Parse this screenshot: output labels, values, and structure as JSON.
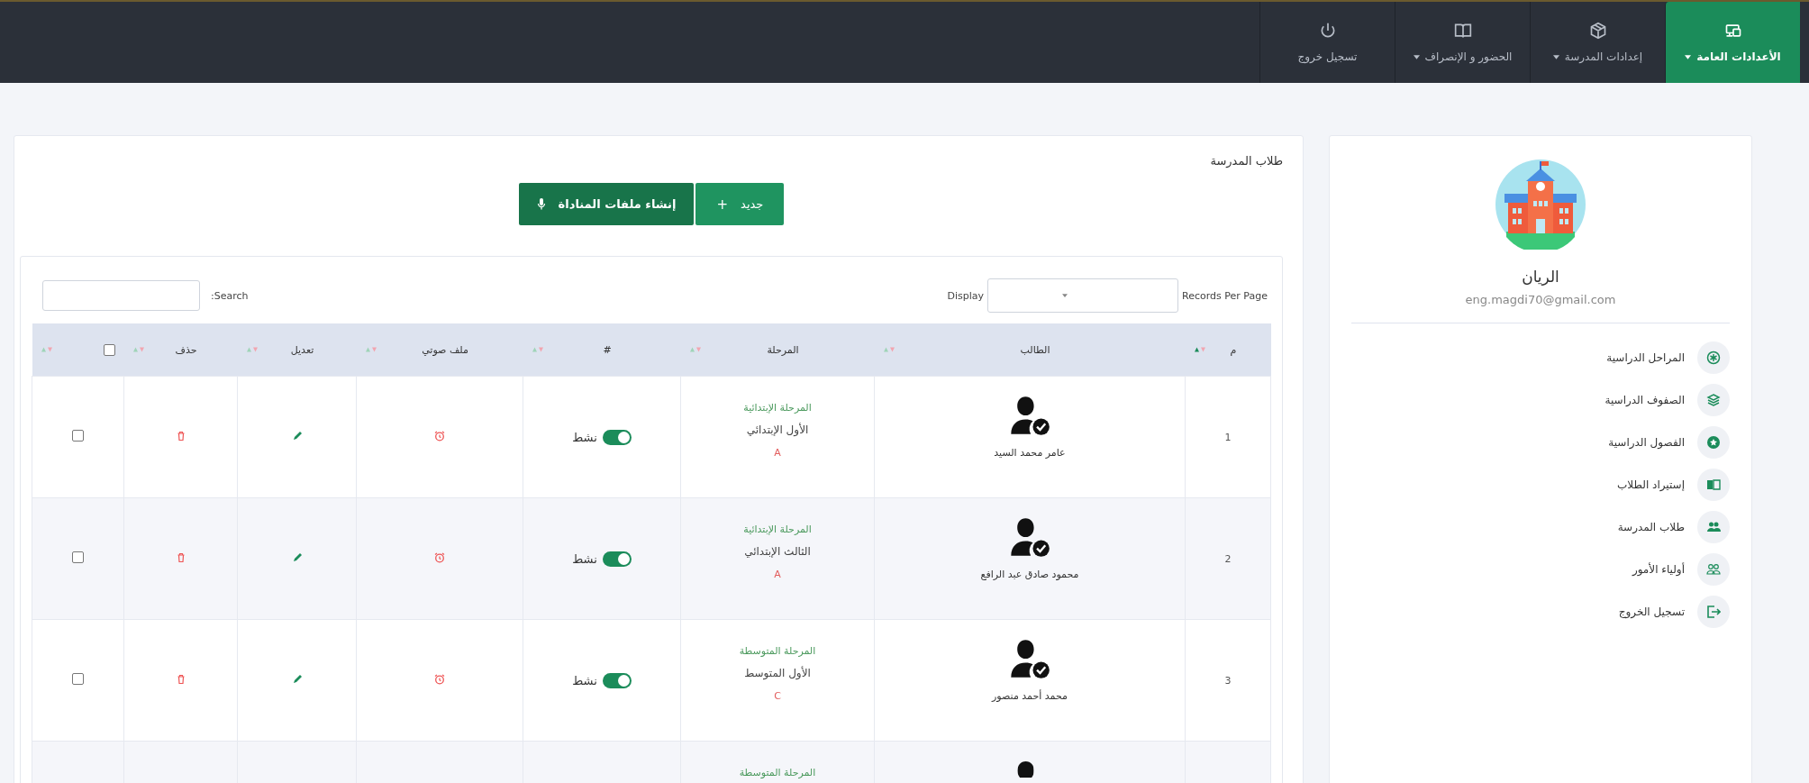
{
  "nav": {
    "items": [
      {
        "label": "الأعدادات العامة",
        "selected": true,
        "dropdown": true
      },
      {
        "label": "إعدادات المدرسة",
        "selected": false,
        "dropdown": true
      },
      {
        "label": "الحضور و الإنصراف",
        "selected": false,
        "dropdown": true
      },
      {
        "label": "تسجيل خروج",
        "selected": false,
        "dropdown": false
      }
    ]
  },
  "sidebar": {
    "name": "الريان",
    "email": "eng.magdi70@gmail.com",
    "items": [
      {
        "label": "المراحل الدراسية"
      },
      {
        "label": "الصفوف الدراسية"
      },
      {
        "label": "الفصول الدراسية"
      },
      {
        "label": "إستيراد الطلاب"
      },
      {
        "label": "طلاب المدرسة"
      },
      {
        "label": "أولياء الأمور"
      },
      {
        "label": "تسجيل الخروج"
      }
    ]
  },
  "main": {
    "title": "طلاب المدرسة",
    "buttons": [
      {
        "label": "جديد",
        "icon_char": "+"
      },
      {
        "label": "إنشاء ملفات المناداة"
      }
    ],
    "toolbar": {
      "records_label": "Records Per Page",
      "display_label": "Display",
      "search_label": "Search:"
    },
    "table": {
      "select_all_checked": false,
      "columns": [
        "م",
        "الطالب",
        "المرحلة",
        "#",
        "ملف صوتي",
        "تعديل",
        "حذف"
      ],
      "rows": [
        {
          "number": "1",
          "name": "عامر محمد السيد",
          "stage": "المرحلة الإبتدائية",
          "grade": "الأول الإبتدائي",
          "section": "A",
          "status": "نشط",
          "active": true,
          "checked": false
        },
        {
          "number": "2",
          "name": "محمود صادق عبد الرافع",
          "stage": "المرحلة الإبتدائية",
          "grade": "الثالث الإبتدائي",
          "section": "A",
          "status": "نشط",
          "active": true,
          "checked": false
        },
        {
          "number": "3",
          "name": "محمد أحمد منصور",
          "stage": "المرحلة المتوسطة",
          "grade": "الأول المتوسط",
          "section": "C",
          "status": "نشط",
          "active": true,
          "checked": false
        },
        {
          "stage": "المرحلة المتوسطة"
        }
      ]
    }
  }
}
